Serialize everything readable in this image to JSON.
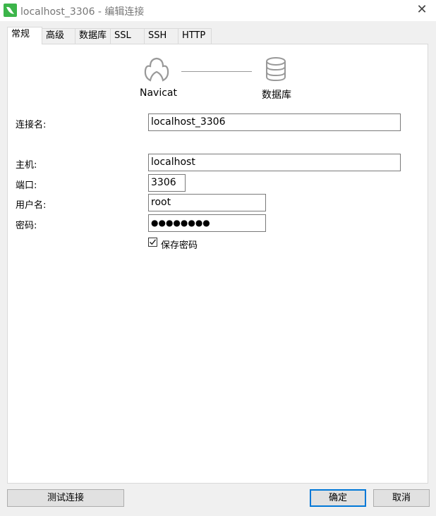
{
  "window": {
    "title": "localhost_3306 - 编辑连接",
    "close": "✕"
  },
  "tabs": [
    {
      "label": "常规"
    },
    {
      "label": "高级"
    },
    {
      "label": "数据库"
    },
    {
      "label": "SSL"
    },
    {
      "label": "SSH"
    },
    {
      "label": "HTTP"
    }
  ],
  "diagram": {
    "left_label": "Navicat",
    "right_label": "数据库"
  },
  "form": {
    "conn_name": {
      "label": "连接名:",
      "value": "localhost_3306"
    },
    "host": {
      "label": "主机:",
      "value": "localhost"
    },
    "port": {
      "label": "端口:",
      "value": "3306"
    },
    "user": {
      "label": "用户名:",
      "value": "root"
    },
    "password": {
      "label": "密码:",
      "value": "●●●●●●●●"
    },
    "save_password": {
      "label": "保存密码",
      "checked": true
    }
  },
  "buttons": {
    "test": "测试连接",
    "ok": "确定",
    "cancel": "取消"
  }
}
